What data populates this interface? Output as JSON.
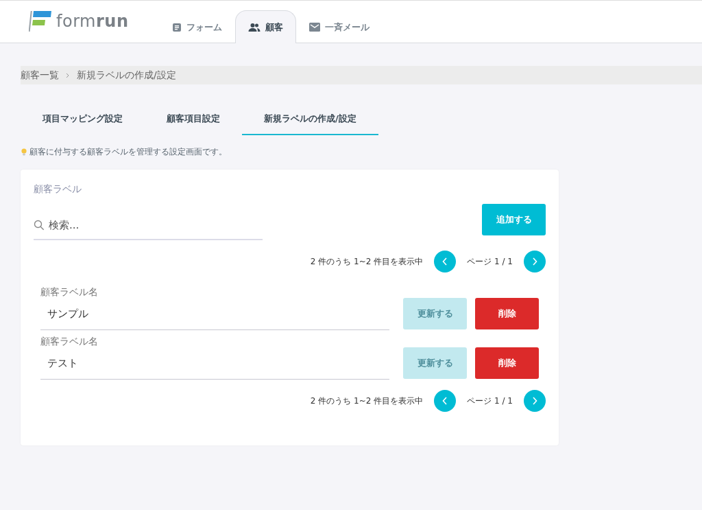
{
  "header": {
    "logo": "form**run**",
    "nav": [
      {
        "label": "フォーム",
        "kind": "form",
        "selected": false
      },
      {
        "label": "顧客",
        "kind": "customer",
        "selected": true
      },
      {
        "label": "一斉メール",
        "kind": "mail",
        "selected": false
      }
    ]
  },
  "breadcrumb": [
    "顧客一覧",
    "新規ラベルの作成/設定"
  ],
  "tabs": [
    {
      "label": "項目マッピング設定",
      "selected": false
    },
    {
      "label": "顧客項目設定",
      "selected": false
    },
    {
      "label": "新規ラベルの作成/設定",
      "selected": true
    }
  ],
  "hint": "顧客に付与する顧客ラベルを管理する設定画面です。",
  "card": {
    "title": "顧客ラベル",
    "search": {
      "placeholder": "検索..."
    },
    "add_button": "追加する",
    "pagination_top": {
      "summary": "2 件のうち 1~2 件目を表示中",
      "page": "ページ 1 / 1"
    },
    "labels": [
      {
        "field_label": "顧客ラベル名",
        "value": "サンプル",
        "update_button": "更新する",
        "update_disabled": true,
        "delete_button": "削除"
      },
      {
        "field_label": "顧客ラベル名",
        "value": "テスト",
        "update_button": "更新する",
        "update_disabled": true,
        "delete_button": "削除"
      }
    ],
    "pagination_bottom": {
      "summary": "2 件のうち 1~2 件目を表示中",
      "page": "ページ 1 / 1"
    }
  }
}
